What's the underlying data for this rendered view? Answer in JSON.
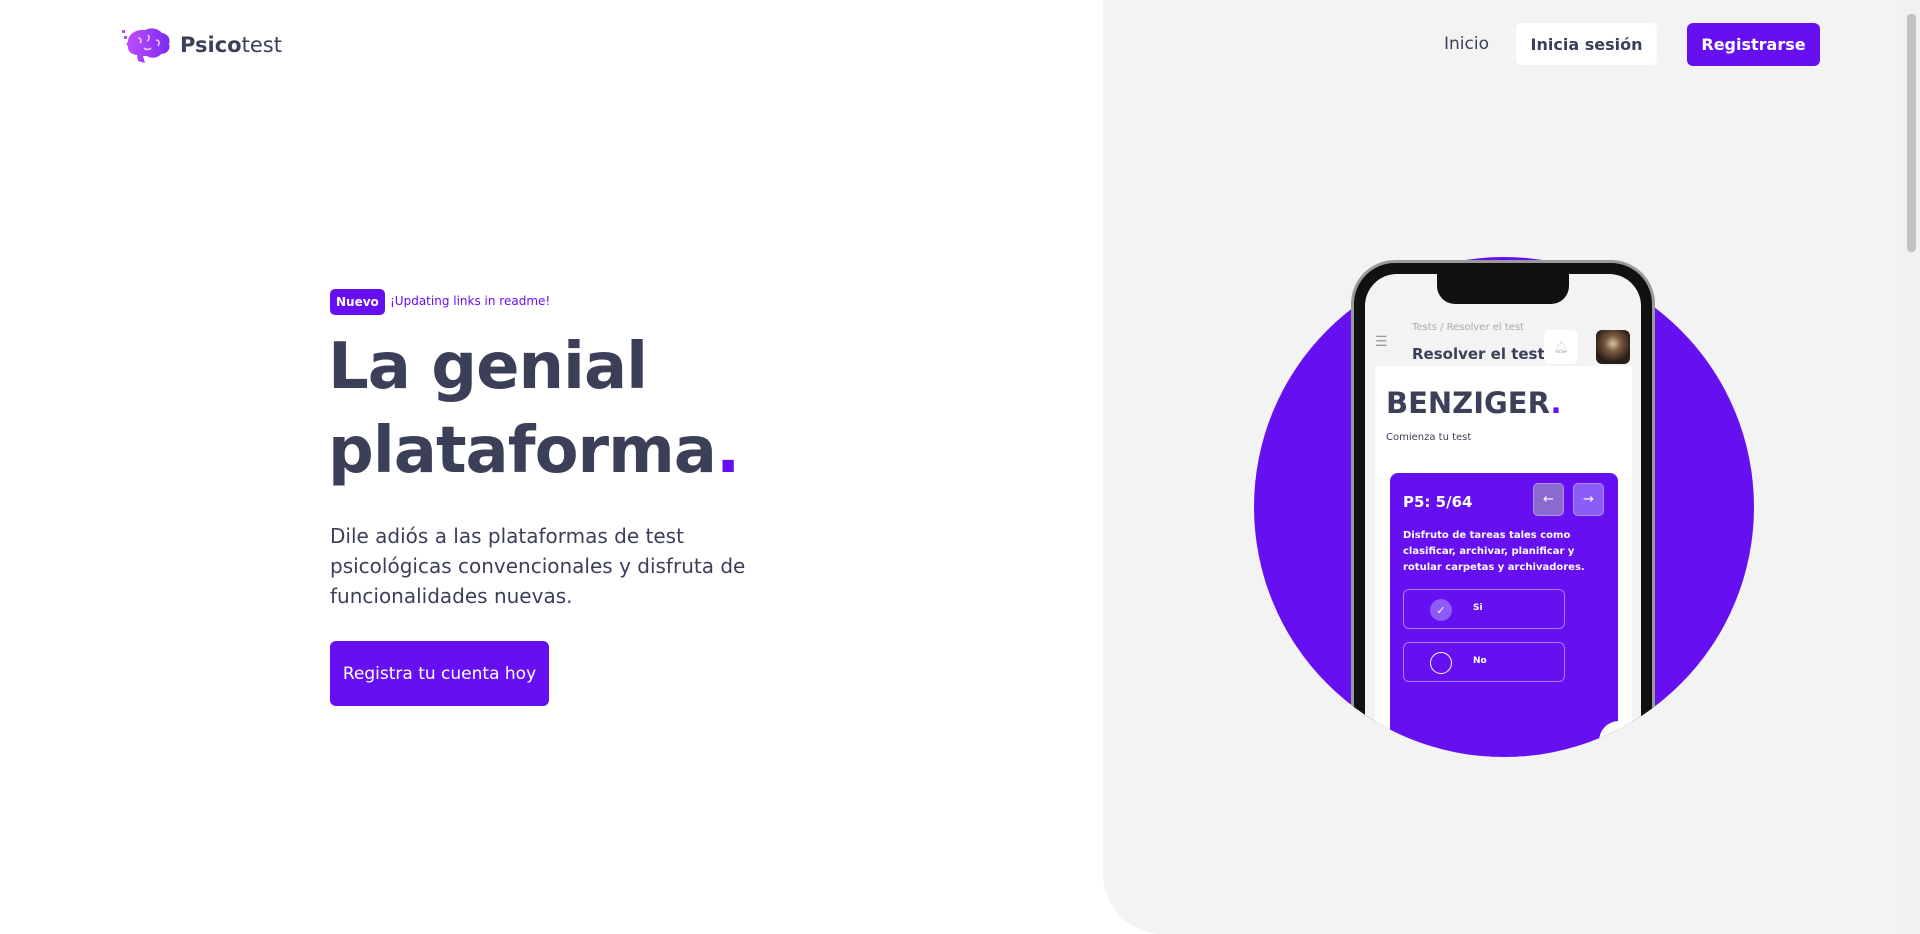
{
  "header": {
    "brand_bold": "Psico",
    "brand_rest": "test",
    "nav_home": "Inicio",
    "login": "Inicia sesión",
    "register": "Registrarse"
  },
  "hero": {
    "badge": "Nuevo",
    "badge_text": "¡Updating links in readme!",
    "title_line1": "La genial",
    "title_line2": "plataforma",
    "title_dot": ".",
    "lead": "Dile adiós a las plataformas de test psicológicas convencionales y disfruta de funcionalidades nuevas.",
    "cta": "Registra tu cuenta hoy"
  },
  "phone": {
    "breadcrumb": "Tests / Resolver el test",
    "page_title": "Resolver el test",
    "test_name": "BENZIGER",
    "test_dot": ".",
    "subtitle": "Comienza tu test",
    "progress": "P5: 5/64",
    "prev": "←",
    "next": "→",
    "question": "Disfruto de tareas tales como clasificar, archivar, planificar y rotular carpetas y archivadores.",
    "options": [
      {
        "label": "Si",
        "selected": true
      },
      {
        "label": "No",
        "selected": false
      }
    ]
  },
  "colors": {
    "accent": "#6610f2",
    "text": "#3c3f58",
    "panel": "#f3f3f3"
  }
}
